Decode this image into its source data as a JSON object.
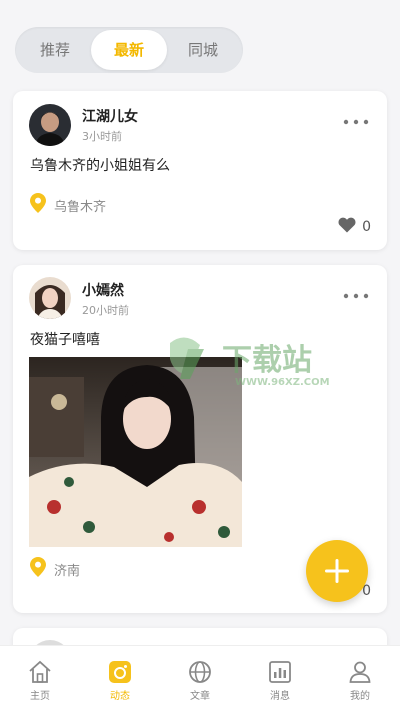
{
  "tabs_top": [
    "推荐",
    "最新",
    "同城"
  ],
  "active_top_tab": "最新",
  "posts": [
    {
      "username": "江湖儿女",
      "time": "3小时前",
      "content": "乌鲁木齐的小姐姐有么",
      "location": "乌鲁木齐",
      "likes": "0"
    },
    {
      "username": "小嫣然",
      "time": "20小时前",
      "content": "夜猫子嘻嘻",
      "location": "济南",
      "likes": "0"
    }
  ],
  "watermark": {
    "text": "下载站",
    "url": "WWW.96XZ.COM"
  },
  "bottom_nav": [
    {
      "label": "主页",
      "icon": "home-icon"
    },
    {
      "label": "动态",
      "icon": "moments-icon"
    },
    {
      "label": "文章",
      "icon": "globe-icon"
    },
    {
      "label": "消息",
      "icon": "chart-icon"
    },
    {
      "label": "我的",
      "icon": "user-icon"
    }
  ],
  "active_bottom": "动态",
  "colors": {
    "accent": "#f3b800",
    "background": "#f5f5f7"
  }
}
